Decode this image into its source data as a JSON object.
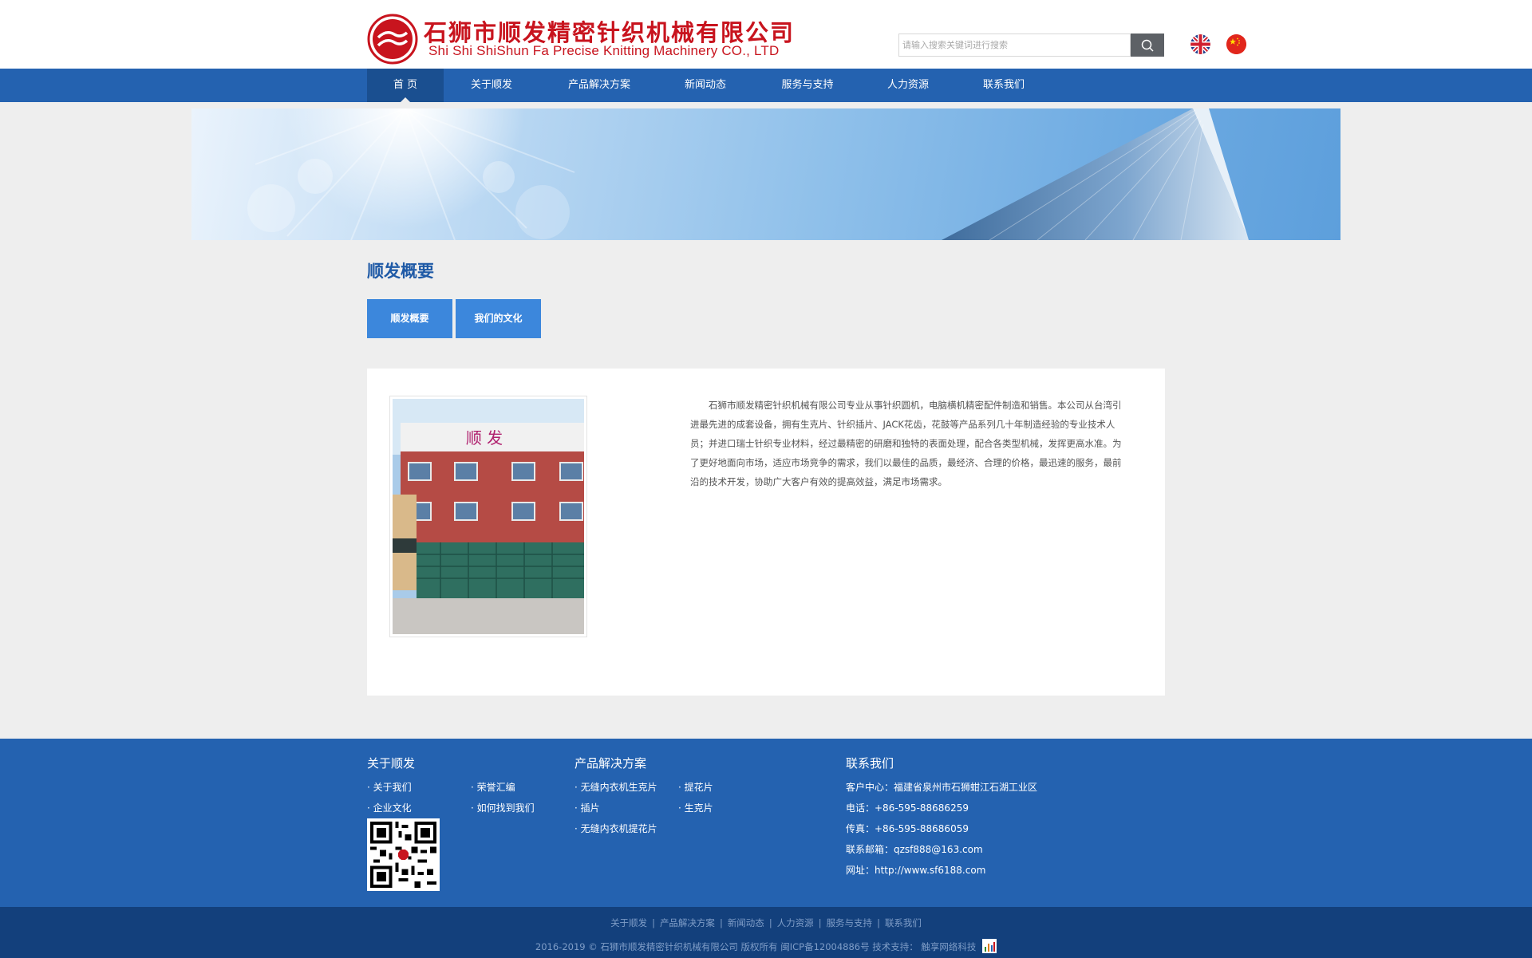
{
  "header": {
    "company_cn": "石狮市顺发精密针织机械有限公司",
    "company_en": "Shi Shi ShiShun Fa Precise Knitting Machinery CO., LTD",
    "search_placeholder": "请输入搜索关键词进行搜索",
    "logo_icon": "company-logo-icon",
    "search_icon": "magnifier-icon",
    "flags": [
      "uk-flag-icon",
      "china-flag-icon"
    ]
  },
  "nav": {
    "items": [
      {
        "label": "首 页"
      },
      {
        "label": "关于顺发"
      },
      {
        "label": "产品解决方案"
      },
      {
        "label": "新闻动态"
      },
      {
        "label": "服务与支持"
      },
      {
        "label": "人力资源"
      },
      {
        "label": "联系我们"
      }
    ],
    "active_index": 0
  },
  "section": {
    "title": "顺发概要",
    "tabs": [
      {
        "label": "顺发概要"
      },
      {
        "label": "我们的文化"
      }
    ]
  },
  "content": {
    "photo_sign": "顺 发",
    "text": "石狮市顺发精密针织机械有限公司专业从事针织圆机，电脑横机精密配件制造和销售。本公司从台湾引进最先进的成套设备，拥有生克片、针织插片、JACK花齿，花鼓等产品系列几十年制造经验的专业技术人员；并进口瑞士针织专业材料，经过最精密的研磨和独特的表面处理，配合各类型机械，发挥更高水准。为了更好地面向市场，适应市场竞争的需求，我们以最佳的品质，最经济、合理的价格，最迅速的服务，最前沿的技术开发，协助广大客户有效的提高效益，满足市场需求。"
  },
  "footer": {
    "about": {
      "title": "关于顺发",
      "links": [
        "· 关于我们",
        "· 荣誉汇编",
        "· 企业文化",
        "· 如何找到我们"
      ]
    },
    "products": {
      "title": "产品解决方案",
      "links": [
        "· 无缝内衣机生克片",
        "· 提花片",
        "· 插片",
        "· 生克片",
        "· 无缝内衣机提花片"
      ]
    },
    "contact": {
      "title": "联系我们",
      "lines": [
        "客户中心：福建省泉州市石狮蚶江石湖工业区",
        "电话：+86-595-88686259",
        "传真：+86-595-88686059",
        "联系邮箱：qzsf888@163.com",
        "网址：http://www.sf6188.com"
      ]
    },
    "bottom_links": [
      "关于顺发",
      "产品解决方案",
      "新闻动态",
      "人力资源",
      "服务与支持",
      "联系我们"
    ],
    "copyright": "2016-2019 © 石狮市顺发精密针织机械有限公司 版权所有 闽ICP备12004886号 技术支持： 触享网络科技"
  },
  "colors": {
    "brand_red": "#c8141e",
    "nav_blue": "#2462b0",
    "nav_active": "#1a4f90",
    "tab_blue": "#3c87dc",
    "footer_dark": "#13407c"
  }
}
